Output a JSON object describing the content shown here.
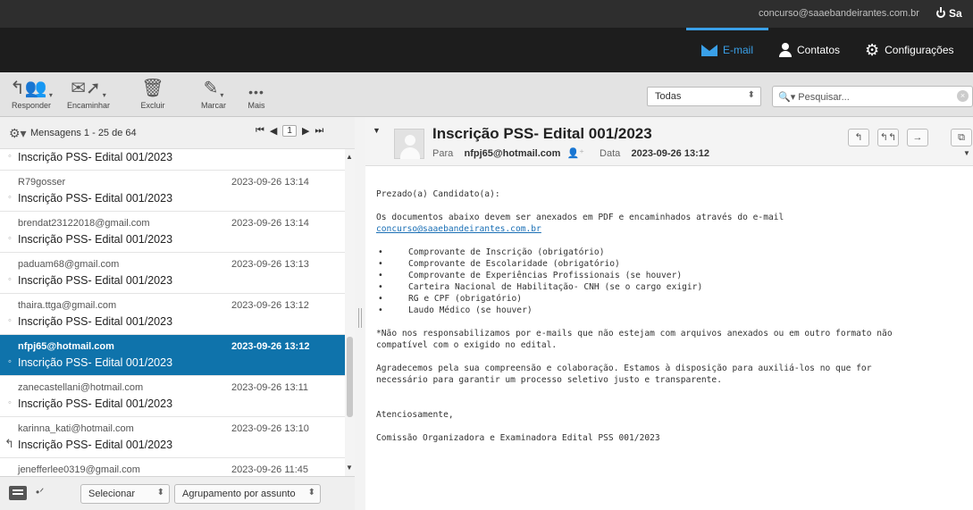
{
  "topbar": {
    "user_email": "concurso@saaebandeirantes.com.br",
    "logout_label": "Sa"
  },
  "nav": {
    "email": "E-mail",
    "contacts": "Contatos",
    "settings": "Configurações"
  },
  "toolbar": {
    "reply": "Responder",
    "forward": "Encaminhar",
    "delete": "Excluir",
    "mark": "Marcar",
    "more": "Mais",
    "filter_value": "Todas",
    "search_placeholder": "Pesquisar..."
  },
  "list": {
    "count_label": "Mensagens 1 - 25 de 64",
    "page": "1",
    "messages": [
      {
        "from": "",
        "date": "",
        "subject": "Inscrição PSS- Edital 001/2023"
      },
      {
        "from": "R79gosser",
        "date": "2023-09-26 13:14",
        "subject": "Inscrição PSS- Edital 001/2023"
      },
      {
        "from": "brendat23122018@gmail.com",
        "date": "2023-09-26 13:14",
        "subject": "Inscrição PSS- Edital 001/2023"
      },
      {
        "from": "paduam68@gmail.com",
        "date": "2023-09-26 13:13",
        "subject": "Inscrição PSS- Edital 001/2023"
      },
      {
        "from": "thaira.ttga@gmail.com",
        "date": "2023-09-26 13:12",
        "subject": "Inscrição PSS- Edital 001/2023"
      },
      {
        "from": "nfpj65@hotmail.com",
        "date": "2023-09-26 13:12",
        "subject": "Inscrição PSS- Edital 001/2023"
      },
      {
        "from": "zanecastellani@hotmail.com",
        "date": "2023-09-26 13:11",
        "subject": "Inscrição PSS- Edital 001/2023"
      },
      {
        "from": "karinna_kati@hotmail.com",
        "date": "2023-09-26 13:10",
        "subject": "Inscrição PSS- Edital 001/2023"
      },
      {
        "from": "jenefferlee0319@gmail.com",
        "date": "2023-09-26 11:45",
        "subject": ""
      }
    ],
    "select_label": "Selecionar",
    "group_label": "Agrupamento por assunto"
  },
  "message": {
    "subject": "Inscrição PSS- Edital 001/2023",
    "to_label": "Para",
    "to": "nfpj65@hotmail.com",
    "date_label": "Data",
    "date": "2023-09-26 13:12",
    "greeting": "Prezado(a) Candidato(a):",
    "intro": "Os documentos abaixo devem ser anexados em PDF e encaminhados através do e-mail",
    "link": "concurso@saaebandeirantes.com.br",
    "items": [
      "Comprovante de Inscrição (obrigatório)",
      "Comprovante de Escolaridade (obrigatório)",
      "Comprovante de Experiências Profissionais (se houver)",
      "Carteira Nacional de Habilitação- CNH (se o cargo exigir)",
      "RG e CPF (obrigatório)",
      "Laudo Médico (se houver)"
    ],
    "note_1": "*Não nos responsabilizamos por e-mails que não estejam com arquivos anexados ou em outro formato não",
    "note_2": "compatível com o exigido no edital.",
    "thanks_1": "Agradecemos pela sua compreensão e colaboração. Estamos à disposição para auxiliá-los no que for",
    "thanks_2": "necessário para garantir um processo seletivo justo e transparente.",
    "closing": "Atenciosamente,",
    "signature": "Comissão Organizadora e Examinadora Edital PSS 001/2023"
  }
}
